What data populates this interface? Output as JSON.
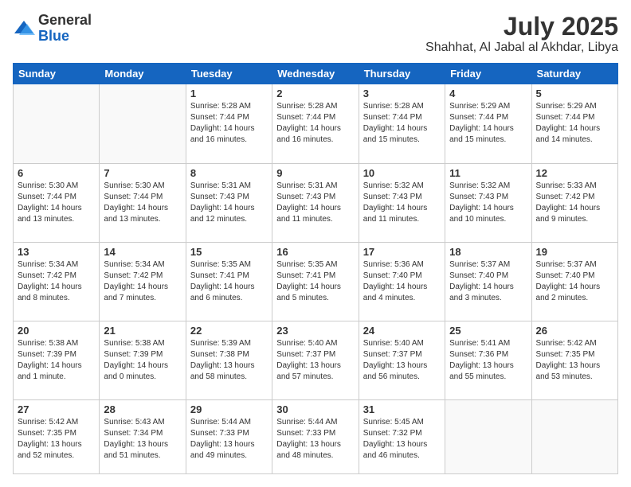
{
  "header": {
    "logo_general": "General",
    "logo_blue": "Blue",
    "month": "July 2025",
    "location": "Shahhat, Al Jabal al Akhdar, Libya"
  },
  "days_of_week": [
    "Sunday",
    "Monday",
    "Tuesday",
    "Wednesday",
    "Thursday",
    "Friday",
    "Saturday"
  ],
  "weeks": [
    [
      {
        "day": "",
        "empty": true
      },
      {
        "day": "",
        "empty": true
      },
      {
        "day": "1",
        "sunrise": "5:28 AM",
        "sunset": "7:44 PM",
        "daylight": "14 hours and 16 minutes."
      },
      {
        "day": "2",
        "sunrise": "5:28 AM",
        "sunset": "7:44 PM",
        "daylight": "14 hours and 16 minutes."
      },
      {
        "day": "3",
        "sunrise": "5:28 AM",
        "sunset": "7:44 PM",
        "daylight": "14 hours and 15 minutes."
      },
      {
        "day": "4",
        "sunrise": "5:29 AM",
        "sunset": "7:44 PM",
        "daylight": "14 hours and 15 minutes."
      },
      {
        "day": "5",
        "sunrise": "5:29 AM",
        "sunset": "7:44 PM",
        "daylight": "14 hours and 14 minutes."
      }
    ],
    [
      {
        "day": "6",
        "sunrise": "5:30 AM",
        "sunset": "7:44 PM",
        "daylight": "14 hours and 13 minutes."
      },
      {
        "day": "7",
        "sunrise": "5:30 AM",
        "sunset": "7:44 PM",
        "daylight": "14 hours and 13 minutes."
      },
      {
        "day": "8",
        "sunrise": "5:31 AM",
        "sunset": "7:43 PM",
        "daylight": "14 hours and 12 minutes."
      },
      {
        "day": "9",
        "sunrise": "5:31 AM",
        "sunset": "7:43 PM",
        "daylight": "14 hours and 11 minutes."
      },
      {
        "day": "10",
        "sunrise": "5:32 AM",
        "sunset": "7:43 PM",
        "daylight": "14 hours and 11 minutes."
      },
      {
        "day": "11",
        "sunrise": "5:32 AM",
        "sunset": "7:43 PM",
        "daylight": "14 hours and 10 minutes."
      },
      {
        "day": "12",
        "sunrise": "5:33 AM",
        "sunset": "7:42 PM",
        "daylight": "14 hours and 9 minutes."
      }
    ],
    [
      {
        "day": "13",
        "sunrise": "5:34 AM",
        "sunset": "7:42 PM",
        "daylight": "14 hours and 8 minutes."
      },
      {
        "day": "14",
        "sunrise": "5:34 AM",
        "sunset": "7:42 PM",
        "daylight": "14 hours and 7 minutes."
      },
      {
        "day": "15",
        "sunrise": "5:35 AM",
        "sunset": "7:41 PM",
        "daylight": "14 hours and 6 minutes."
      },
      {
        "day": "16",
        "sunrise": "5:35 AM",
        "sunset": "7:41 PM",
        "daylight": "14 hours and 5 minutes."
      },
      {
        "day": "17",
        "sunrise": "5:36 AM",
        "sunset": "7:40 PM",
        "daylight": "14 hours and 4 minutes."
      },
      {
        "day": "18",
        "sunrise": "5:37 AM",
        "sunset": "7:40 PM",
        "daylight": "14 hours and 3 minutes."
      },
      {
        "day": "19",
        "sunrise": "5:37 AM",
        "sunset": "7:40 PM",
        "daylight": "14 hours and 2 minutes."
      }
    ],
    [
      {
        "day": "20",
        "sunrise": "5:38 AM",
        "sunset": "7:39 PM",
        "daylight": "14 hours and 1 minute."
      },
      {
        "day": "21",
        "sunrise": "5:38 AM",
        "sunset": "7:39 PM",
        "daylight": "14 hours and 0 minutes."
      },
      {
        "day": "22",
        "sunrise": "5:39 AM",
        "sunset": "7:38 PM",
        "daylight": "13 hours and 58 minutes."
      },
      {
        "day": "23",
        "sunrise": "5:40 AM",
        "sunset": "7:37 PM",
        "daylight": "13 hours and 57 minutes."
      },
      {
        "day": "24",
        "sunrise": "5:40 AM",
        "sunset": "7:37 PM",
        "daylight": "13 hours and 56 minutes."
      },
      {
        "day": "25",
        "sunrise": "5:41 AM",
        "sunset": "7:36 PM",
        "daylight": "13 hours and 55 minutes."
      },
      {
        "day": "26",
        "sunrise": "5:42 AM",
        "sunset": "7:35 PM",
        "daylight": "13 hours and 53 minutes."
      }
    ],
    [
      {
        "day": "27",
        "sunrise": "5:42 AM",
        "sunset": "7:35 PM",
        "daylight": "13 hours and 52 minutes."
      },
      {
        "day": "28",
        "sunrise": "5:43 AM",
        "sunset": "7:34 PM",
        "daylight": "13 hours and 51 minutes."
      },
      {
        "day": "29",
        "sunrise": "5:44 AM",
        "sunset": "7:33 PM",
        "daylight": "13 hours and 49 minutes."
      },
      {
        "day": "30",
        "sunrise": "5:44 AM",
        "sunset": "7:33 PM",
        "daylight": "13 hours and 48 minutes."
      },
      {
        "day": "31",
        "sunrise": "5:45 AM",
        "sunset": "7:32 PM",
        "daylight": "13 hours and 46 minutes."
      },
      {
        "day": "",
        "empty": true
      },
      {
        "day": "",
        "empty": true
      }
    ]
  ],
  "labels": {
    "sunrise": "Sunrise:",
    "sunset": "Sunset:",
    "daylight": "Daylight:"
  }
}
